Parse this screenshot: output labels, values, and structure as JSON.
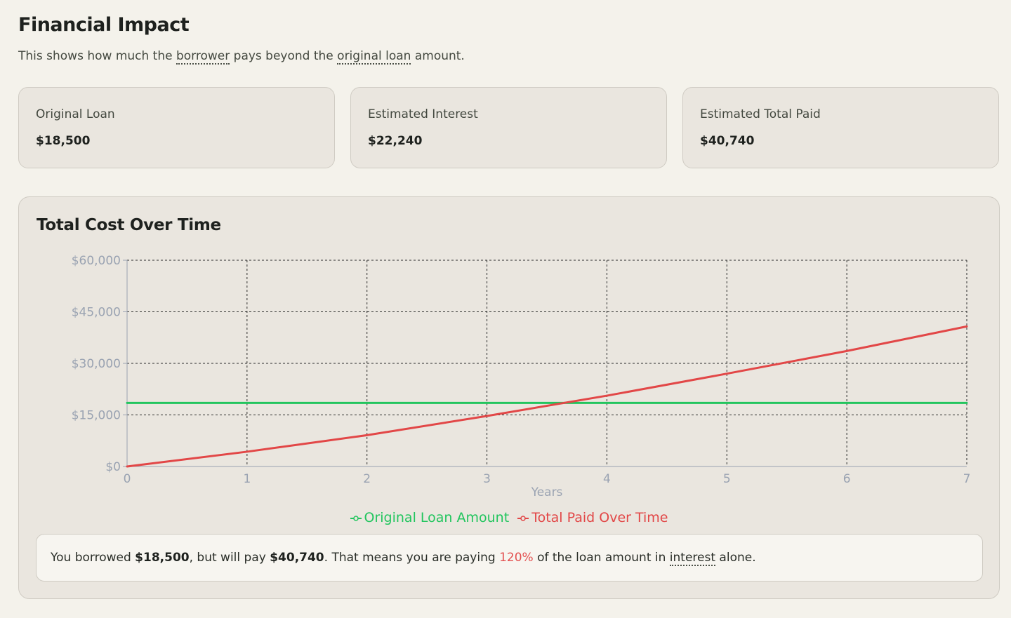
{
  "header": {
    "title": "Financial Impact",
    "subtitle_parts": [
      "This shows how much the ",
      "borrower",
      " pays beyond the ",
      "original loan",
      " amount."
    ]
  },
  "cards": [
    {
      "label": "Original Loan",
      "value": "$18,500"
    },
    {
      "label": "Estimated Interest",
      "value": "$22,240"
    },
    {
      "label": "Estimated Total Paid",
      "value": "$40,740"
    }
  ],
  "colors": {
    "green": "#22c55e",
    "red": "#e24747",
    "axis_text": "#9aa3b2",
    "grid": "#2b2b2b"
  },
  "chart_data": {
    "type": "line",
    "title": "Total Cost Over Time",
    "xlabel": "Years",
    "ylabel": "",
    "xlim": [
      0,
      7
    ],
    "ylim": [
      0,
      60000
    ],
    "x_ticks": [
      "0",
      "1",
      "2",
      "3",
      "4",
      "5",
      "6",
      "7"
    ],
    "y_ticks": [
      "$0",
      "$15,000",
      "$30,000",
      "$45,000",
      "$60,000"
    ],
    "grid": true,
    "legend_position": "bottom",
    "x": [
      0,
      1,
      2,
      3,
      4,
      5,
      6,
      7
    ],
    "series": [
      {
        "name": "Original Loan Amount",
        "color": "#22c55e",
        "values": [
          18500,
          18500,
          18500,
          18500,
          18500,
          18500,
          18500,
          18500
        ]
      },
      {
        "name": "Total Paid Over Time",
        "color": "#e24747",
        "values": [
          0,
          4300,
          9100,
          14700,
          20600,
          27000,
          33600,
          40740
        ]
      }
    ]
  },
  "summary": {
    "part1": "You borrowed ",
    "borrowed": "$18,500",
    "part2": ", but will pay ",
    "total": "$40,740",
    "part3": ". That means you are paying ",
    "percent": "120%",
    "part4": " of the loan amount in ",
    "term": "interest",
    "part5": " alone."
  }
}
